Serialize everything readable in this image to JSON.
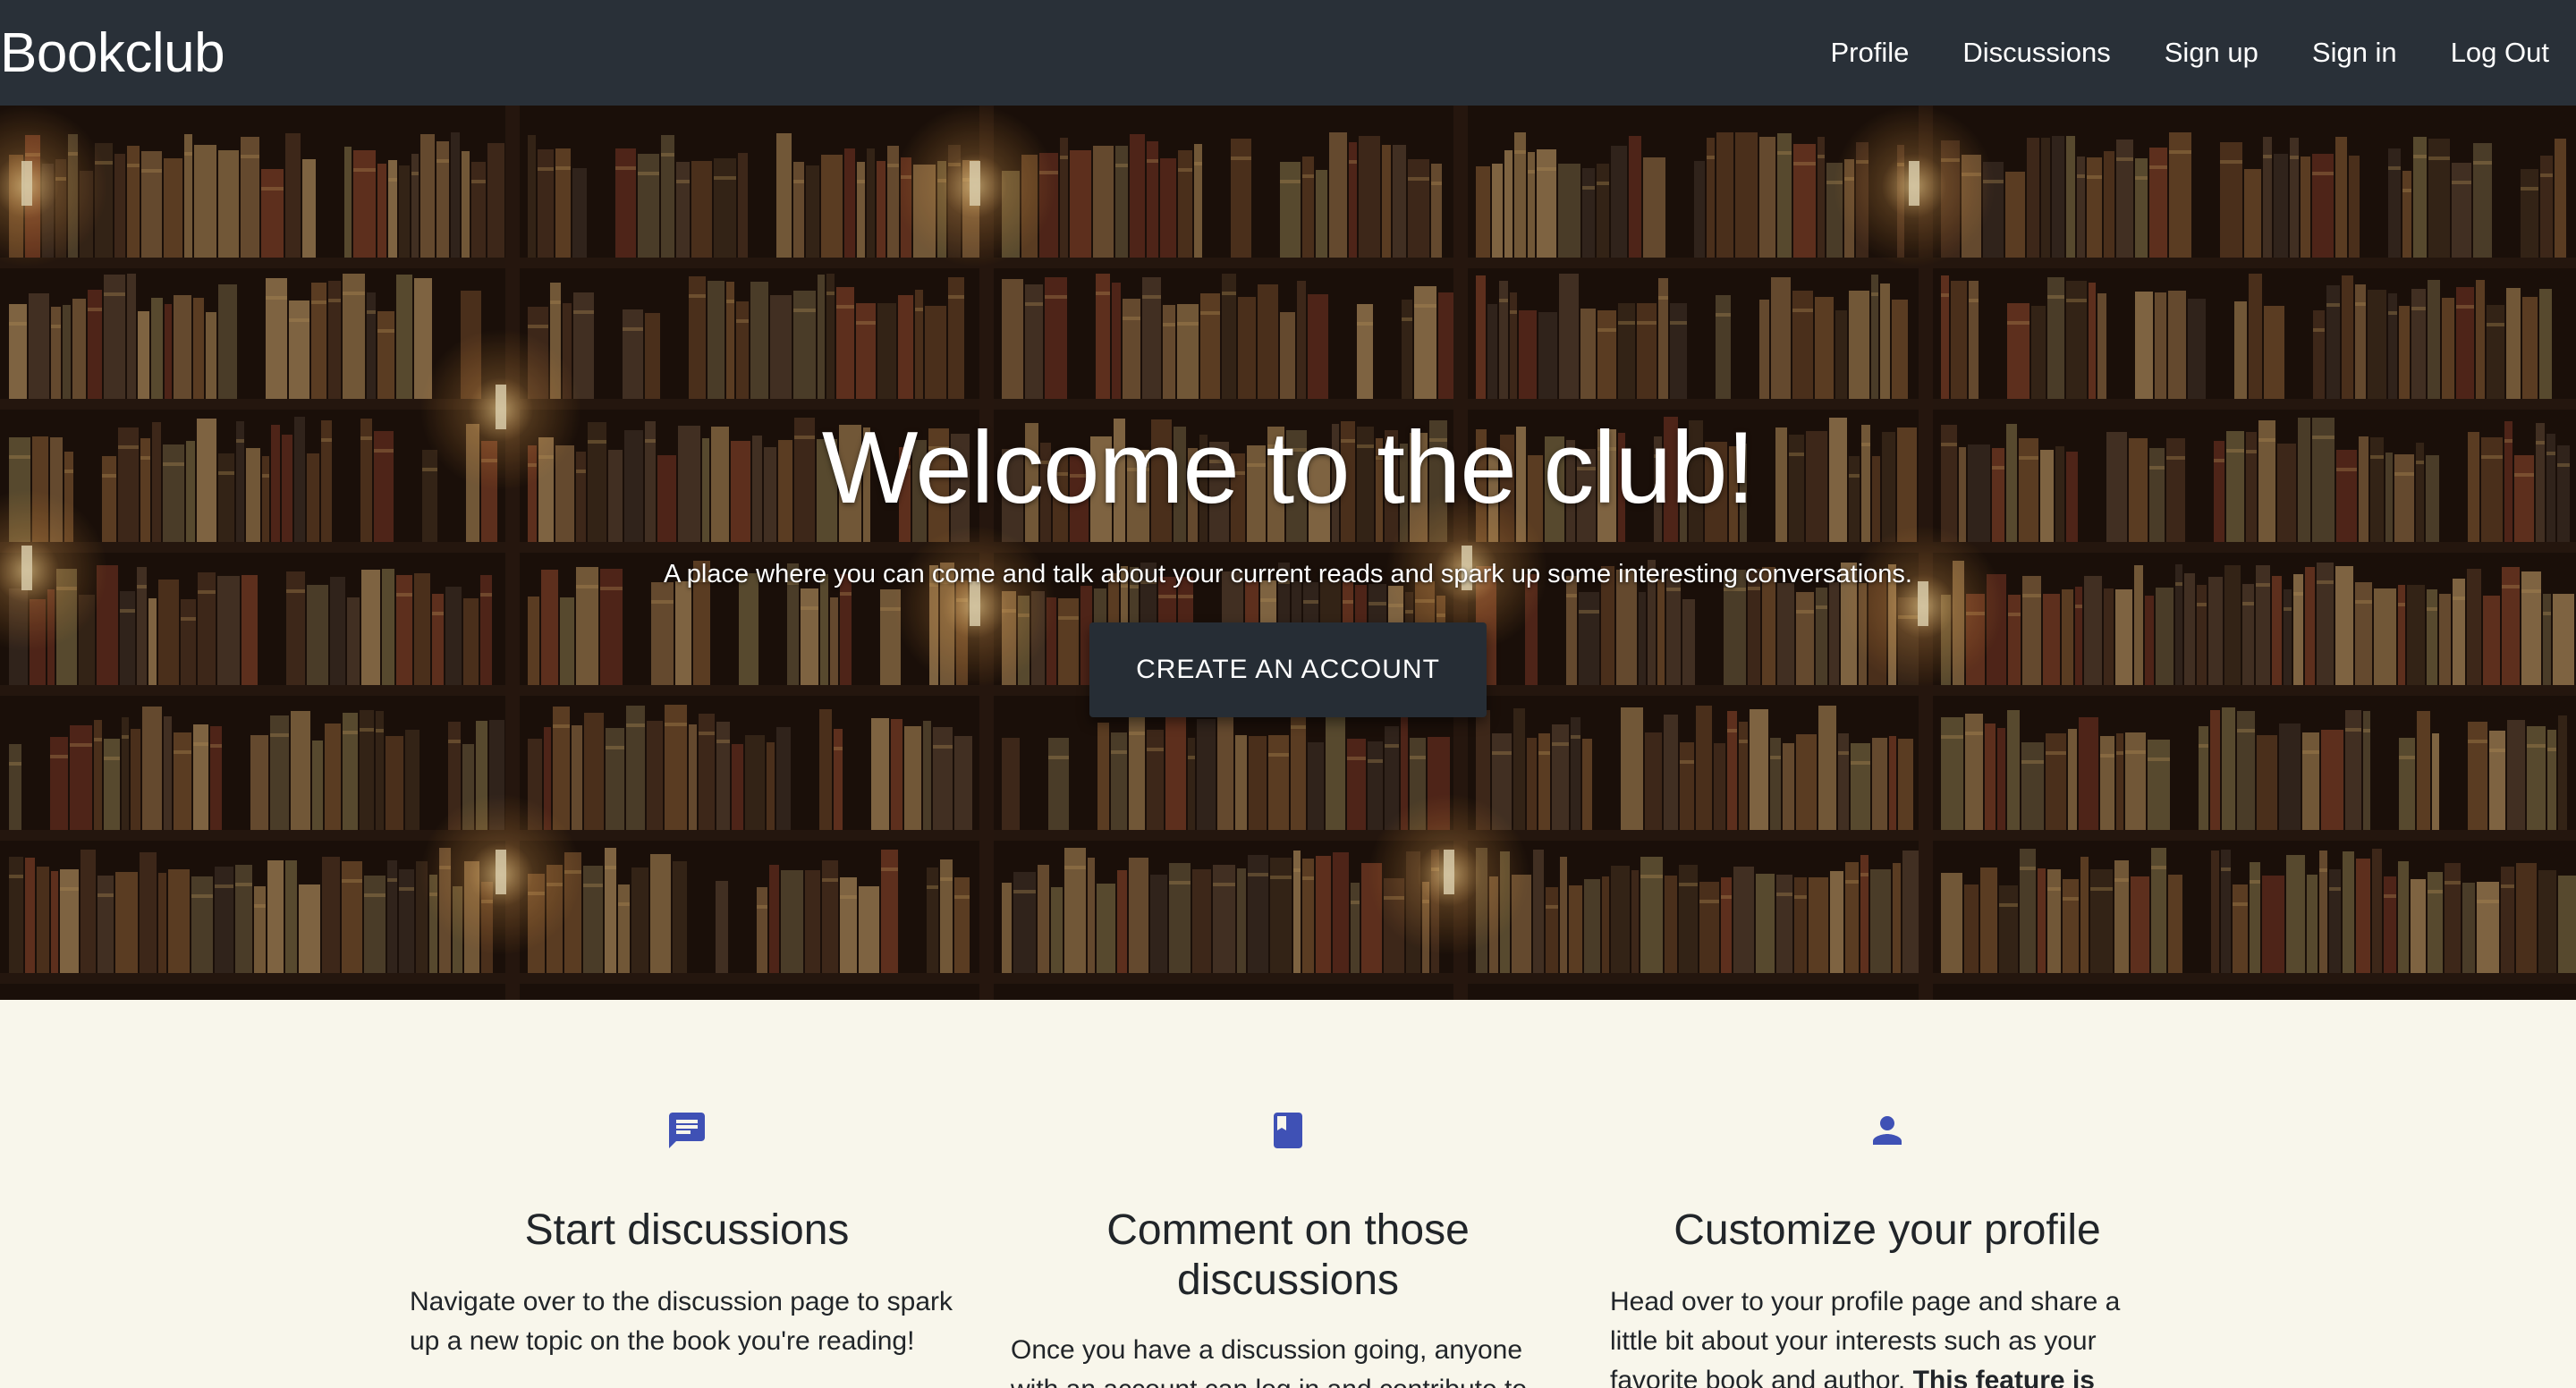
{
  "navbar": {
    "brand": "Bookclub",
    "links": [
      "Profile",
      "Discussions",
      "Sign up",
      "Sign in",
      "Log Out"
    ]
  },
  "hero": {
    "title": "Welcome to the club!",
    "subtitle": "A place where you can come and talk about your current reads and spark up some interesting conversations.",
    "cta_label": "CREATE AN ACCOUNT"
  },
  "features": [
    {
      "icon": "chat-icon",
      "title": "Start discussions",
      "text": "Navigate over to the discussion page to spark up a new topic on the book you're reading!"
    },
    {
      "icon": "book-icon",
      "title": "Comment on those discussions",
      "text": "Once you have a discussion going, anyone with an account can log in and contribute to"
    },
    {
      "icon": "person-icon",
      "title": "Customize your profile",
      "text": "Head over to your profile page and share a little bit about your interests such as your favorite book and author.",
      "text_bold": "This feature is"
    }
  ],
  "colors": {
    "navbar": "#293038",
    "cta": "#262d35",
    "icon_blue": "#3f51b5",
    "features_bg": "#f8f6eb"
  }
}
